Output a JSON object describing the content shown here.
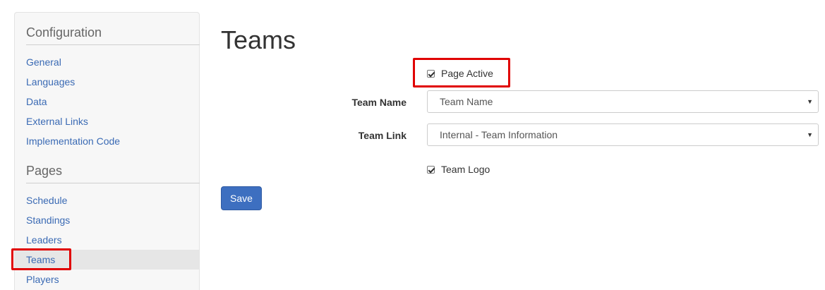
{
  "sidebar": {
    "configuration_heading": "Configuration",
    "configuration_items": [
      {
        "label": "General"
      },
      {
        "label": "Languages"
      },
      {
        "label": "Data"
      },
      {
        "label": "External Links"
      },
      {
        "label": "Implementation Code"
      }
    ],
    "pages_heading": "Pages",
    "pages_items": [
      {
        "label": "Schedule"
      },
      {
        "label": "Standings"
      },
      {
        "label": "Leaders"
      },
      {
        "label": "Teams",
        "active": true
      },
      {
        "label": "Players"
      }
    ]
  },
  "main": {
    "title": "Teams",
    "page_active": {
      "label": "Page Active",
      "checked": true
    },
    "team_name": {
      "label": "Team Name",
      "value": "Team Name"
    },
    "team_link": {
      "label": "Team Link",
      "value": "Internal - Team Information"
    },
    "team_logo": {
      "label": "Team Logo",
      "checked": true
    },
    "save_label": "Save"
  },
  "colors": {
    "link": "#3a6ab4",
    "highlight": "#e00000",
    "primary_button": "#3d6fc0",
    "sidebar_bg": "#f7f7f7",
    "active_item_bg": "#e6e6e6"
  },
  "icons": {
    "checkbox": "checkmark-icon",
    "select_arrow": "caret-down-icon"
  }
}
